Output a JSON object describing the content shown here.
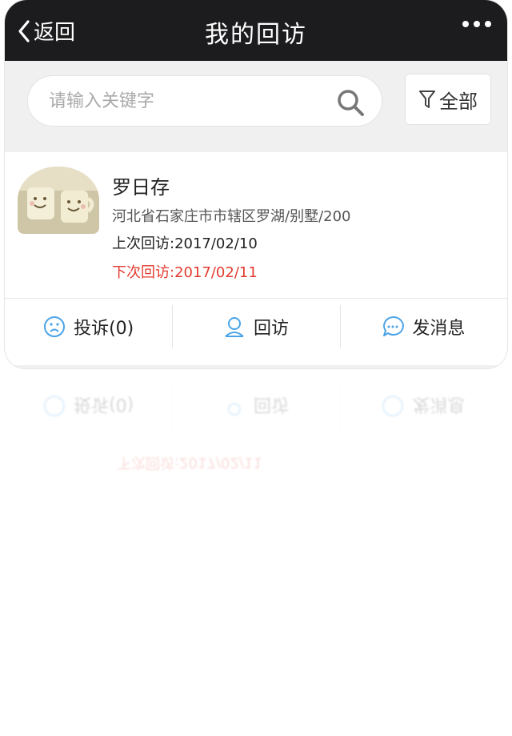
{
  "navbar": {
    "back_label": "返回",
    "title": "我的回访",
    "more_icon": "ellipsis-icon"
  },
  "search": {
    "placeholder": "请输入关键字",
    "value": "",
    "icon": "search-icon"
  },
  "filter": {
    "label": "全部",
    "icon": "filter-icon"
  },
  "record": {
    "name": "罗日存",
    "address": "河北省石家庄市市辖区罗湖/别墅/200",
    "last_visit": "上次回访:2017/02/10",
    "next_visit": "下次回访:2017/02/11",
    "avatar": "avatar-mugs"
  },
  "actions": [
    {
      "label": "投诉(0)",
      "icon": "complaint-face-icon"
    },
    {
      "label": "回访",
      "icon": "person-icon"
    },
    {
      "label": "发消息",
      "icon": "chat-bubble-icon"
    }
  ],
  "colors": {
    "navbar_bg": "#1c1c1e",
    "accent_blue": "#4aa3e8",
    "next_visit_red": "#e23b2e",
    "background": "#f0f0f0"
  }
}
